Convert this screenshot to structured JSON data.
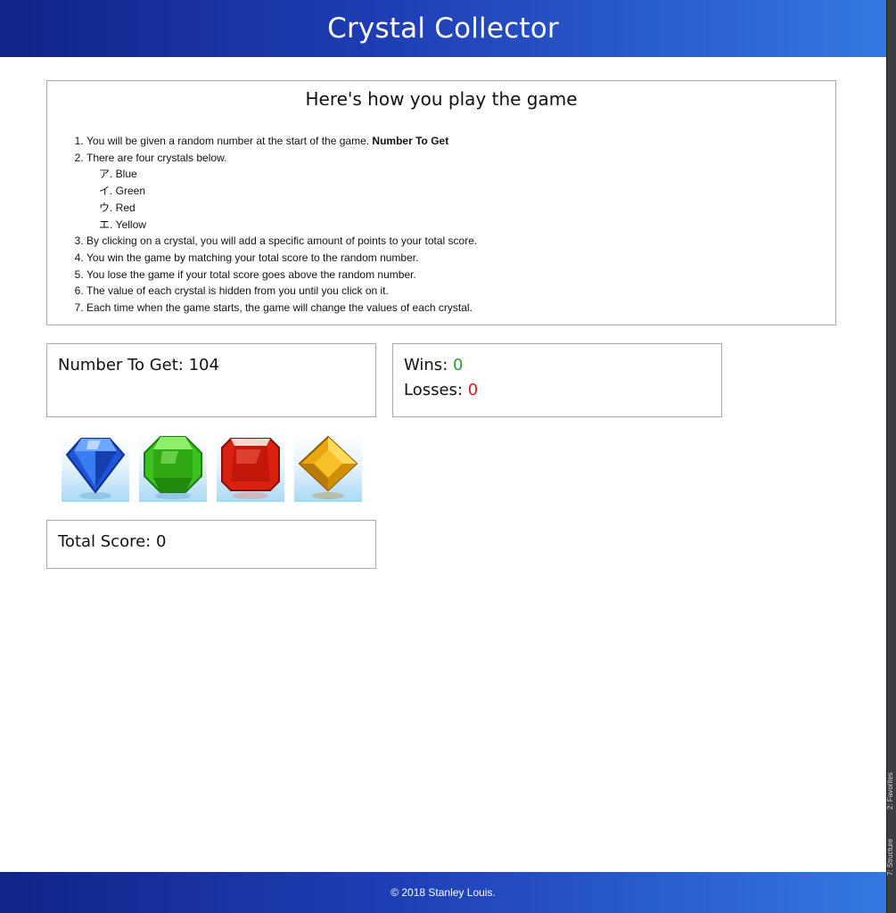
{
  "header": {
    "title": "Crystal Collector"
  },
  "instructions": {
    "title": "Here's how you play the game",
    "step1_text": "You will be given a random number at the start of the game. ",
    "step1_bold": "Number To Get",
    "step2": "There are four crystals below.",
    "crystal_list": [
      {
        "marker": "ア.",
        "name": " Blue"
      },
      {
        "marker": "イ.",
        "name": " Green"
      },
      {
        "marker": "ウ.",
        "name": " Red"
      },
      {
        "marker": "エ.",
        "name": " Yellow"
      }
    ],
    "step3": "By clicking on a crystal, you will add a specific amount of points to your total score.",
    "step4": "You win the game by matching your total score to the random number.",
    "step5": "You lose the game if your total score goes above the random number.",
    "step6": "The value of each crystal is hidden from you until you click on it.",
    "step7": "Each time when the game starts, the game will change the values of each crystal."
  },
  "target": {
    "label": "Number To Get: ",
    "value": "104"
  },
  "record": {
    "wins_label": "Wins: ",
    "wins": "0",
    "losses_label": "Losses: ",
    "losses": "0"
  },
  "crystals": [
    {
      "icon": "blue-diamond-icon",
      "color": "#1f54d9"
    },
    {
      "icon": "green-gem-icon",
      "color": "#3cc21f"
    },
    {
      "icon": "red-gem-icon",
      "color": "#d92011"
    },
    {
      "icon": "yellow-gem-icon",
      "color": "#e9a80d"
    }
  ],
  "score": {
    "label": "Total Score: ",
    "value": "0"
  },
  "side_panel": {
    "tab1": "2: Favorites",
    "tab2": "7: Structure"
  },
  "footer": {
    "text": "© 2018 Stanley Louis."
  },
  "colors": {
    "header_start": "#10248a",
    "header_end": "#3378e0",
    "wins": "#2e9c2e",
    "losses": "#d41c1c"
  }
}
